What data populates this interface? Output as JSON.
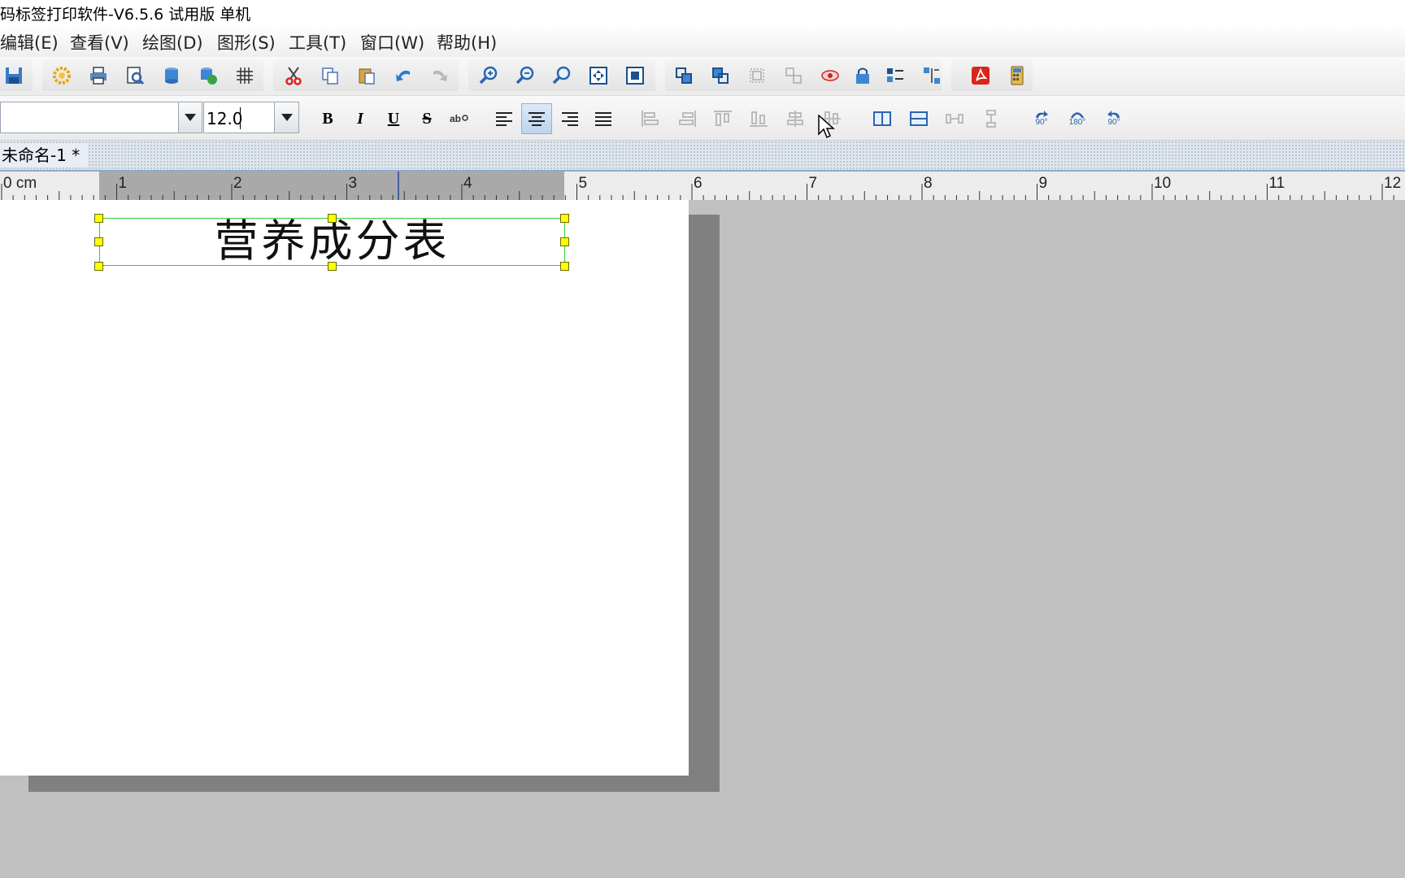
{
  "window": {
    "title": "码标签打印软件-V6.5.6 试用版 单机"
  },
  "menubar": {
    "items": [
      {
        "label": "编辑(E)"
      },
      {
        "label": "查看(V)"
      },
      {
        "label": "绘图(D)"
      },
      {
        "label": "图形(S)"
      },
      {
        "label": "工具(T)"
      },
      {
        "label": "窗口(W)"
      },
      {
        "label": "帮助(H)"
      }
    ]
  },
  "toolbar1": {
    "buttons": [
      {
        "icon": "save-icon"
      },
      {
        "icon": "settings-gear-icon"
      },
      {
        "icon": "print-icon"
      },
      {
        "icon": "print-preview-icon"
      },
      {
        "icon": "database-icon"
      },
      {
        "icon": "database-connect-icon"
      },
      {
        "icon": "grid-icon"
      },
      {
        "icon": "cut-icon"
      },
      {
        "icon": "copy-icon"
      },
      {
        "icon": "paste-icon"
      },
      {
        "icon": "undo-icon"
      },
      {
        "icon": "redo-icon"
      },
      {
        "icon": "zoom-in-icon"
      },
      {
        "icon": "zoom-out-icon"
      },
      {
        "icon": "zoom-actual-icon"
      },
      {
        "icon": "fit-page-icon"
      },
      {
        "icon": "fit-width-icon"
      },
      {
        "icon": "bring-front-icon"
      },
      {
        "icon": "send-back-icon"
      },
      {
        "icon": "group-icon"
      },
      {
        "icon": "ungroup-icon"
      },
      {
        "icon": "view-icon"
      },
      {
        "icon": "lock-icon"
      },
      {
        "icon": "align-objects-icon"
      },
      {
        "icon": "distribute-icon"
      },
      {
        "icon": "pdf-icon"
      },
      {
        "icon": "calculator-icon"
      }
    ]
  },
  "toolbar2": {
    "font_name": "",
    "font_size": "12.0",
    "bold_label": "B",
    "italic_label": "I",
    "underline_label": "U",
    "strike_label": "S",
    "rotate_labels": [
      "90°",
      "180°",
      "90°"
    ]
  },
  "document": {
    "tab_label": "未命名-1 *"
  },
  "ruler": {
    "unit": "cm",
    "labels": [
      "0 cm",
      "1",
      "2",
      "3",
      "4",
      "5",
      "6",
      "7",
      "8",
      "9",
      "10",
      "11",
      "12"
    ]
  },
  "canvas": {
    "selected_text": "营养成分表"
  },
  "colors": {
    "selection_border": "#33cc33",
    "handle": "#ffff00",
    "canvas_bg": "#c0c0c0",
    "page_shadow": "#808080"
  }
}
